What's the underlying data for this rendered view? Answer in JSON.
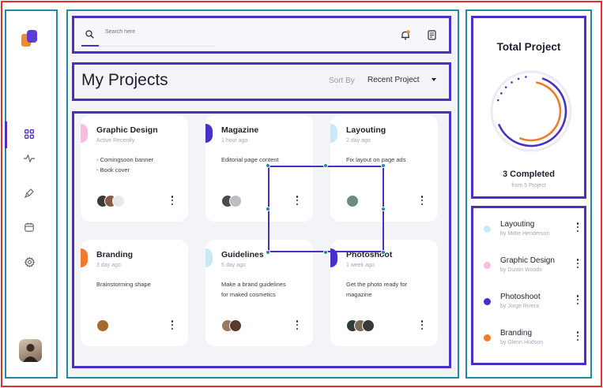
{
  "search": {
    "placeholder": "Search here",
    "icon": "search-icon"
  },
  "header": {
    "title": "My Projects",
    "sort_label": "Sort By",
    "sort_value": "Recent Project"
  },
  "sidebar": {
    "items": [
      {
        "name": "dashboard",
        "icon": "grid-icon",
        "active": true
      },
      {
        "name": "activity",
        "icon": "activity-icon",
        "active": false
      },
      {
        "name": "design",
        "icon": "pen-tool-icon",
        "active": false
      },
      {
        "name": "calendar",
        "icon": "calendar-icon",
        "active": false
      },
      {
        "name": "settings",
        "icon": "gear-icon",
        "active": false
      }
    ]
  },
  "projects": [
    {
      "title": "Graphic Design",
      "subtitle": "Active Recently",
      "desc1": "- Comingsoon banner",
      "desc2": "- Book cover",
      "color": "#f6bde0"
    },
    {
      "title": "Magazine",
      "subtitle": "1 hour ago",
      "desc1": "Editorial page content",
      "desc2": "",
      "color": "#4b2fc4"
    },
    {
      "title": "Layouting",
      "subtitle": "2 day ago",
      "desc1": "Fix layout on page ads",
      "desc2": "",
      "color": "#c9e9f6"
    },
    {
      "title": "Branding",
      "subtitle": "3 day ago",
      "desc1": "Brainstorming shape",
      "desc2": "",
      "color": "#f07a2d"
    },
    {
      "title": "Guidelines",
      "subtitle": "5 day ago",
      "desc1": "Make a brand guidelines",
      "desc2": "for maked cosmetics",
      "color": "#c9e9f6"
    },
    {
      "title": "Photoshoot",
      "subtitle": "1 week ago",
      "desc1": "Get the photo ready for",
      "desc2": "magazine",
      "color": "#4b2fc4"
    }
  ],
  "total": {
    "title": "Total Project",
    "completed": "3 Completed",
    "from": "from 5 Project",
    "completed_count": 3,
    "total_count": 5,
    "ring_colors": [
      "#4b2fc4",
      "#f07a2d"
    ]
  },
  "recent": [
    {
      "name": "Layouting",
      "by": "by Mittie Henderson",
      "color": "#c9e9f6"
    },
    {
      "name": "Graphic Design",
      "by": "by Dustin Woods",
      "color": "#f6bde0"
    },
    {
      "name": "Photoshoot",
      "by": "by Jorge Rivera",
      "color": "#4b2fc4"
    },
    {
      "name": "Branding",
      "by": "by Glenn Hudson",
      "color": "#f07a2d"
    }
  ]
}
